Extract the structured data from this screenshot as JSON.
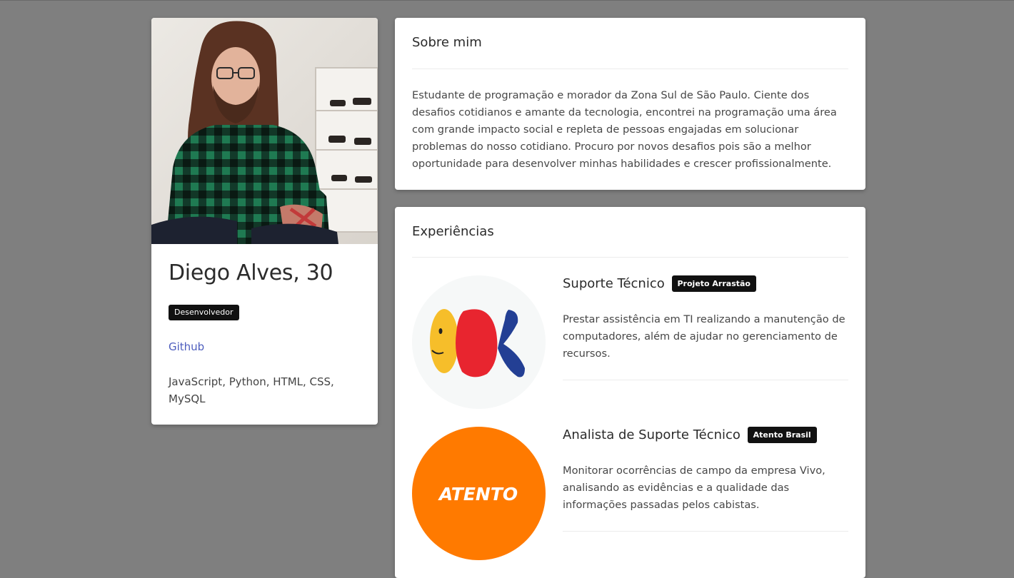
{
  "profile": {
    "name": "Diego Alves, 30",
    "role": "Desenvolvedor",
    "github_label": "Github",
    "skills": "JavaScript, Python, HTML, CSS, MySQL"
  },
  "about": {
    "title": "Sobre mim",
    "text": "Estudante de programação e morador da Zona Sul de São Paulo. Ciente dos desafios cotidianos e amante da tecnologia, encontrei na programação uma área com grande impacto social e repleta de pessoas engajadas em solucionar problemas do nosso cotidiano. Procuro por novos desafios pois são a melhor oportunidade para desenvolver minhas habilidades e crescer profissionalmente."
  },
  "experiences": {
    "title": "Experiências",
    "items": [
      {
        "title": "Suporte Técnico",
        "company": "Projeto Arrastão",
        "description": "Prestar assistência em TI realizando a manutenção de computadores, além de ajudar no gerenciamento de recursos."
      },
      {
        "title": "Analista de Suporte Técnico",
        "company": "Atento Brasil",
        "description": "Monitorar ocorrências de campo da empresa Vivo, analisando as evidências e a qualidade das informações passadas pelos cabistas.",
        "logo_text": "ATENTO"
      }
    ]
  },
  "colors": {
    "background": "#7f7f7f",
    "badge": "#111111",
    "link": "#4d5dbd",
    "atento_orange": "#ff7a00"
  }
}
